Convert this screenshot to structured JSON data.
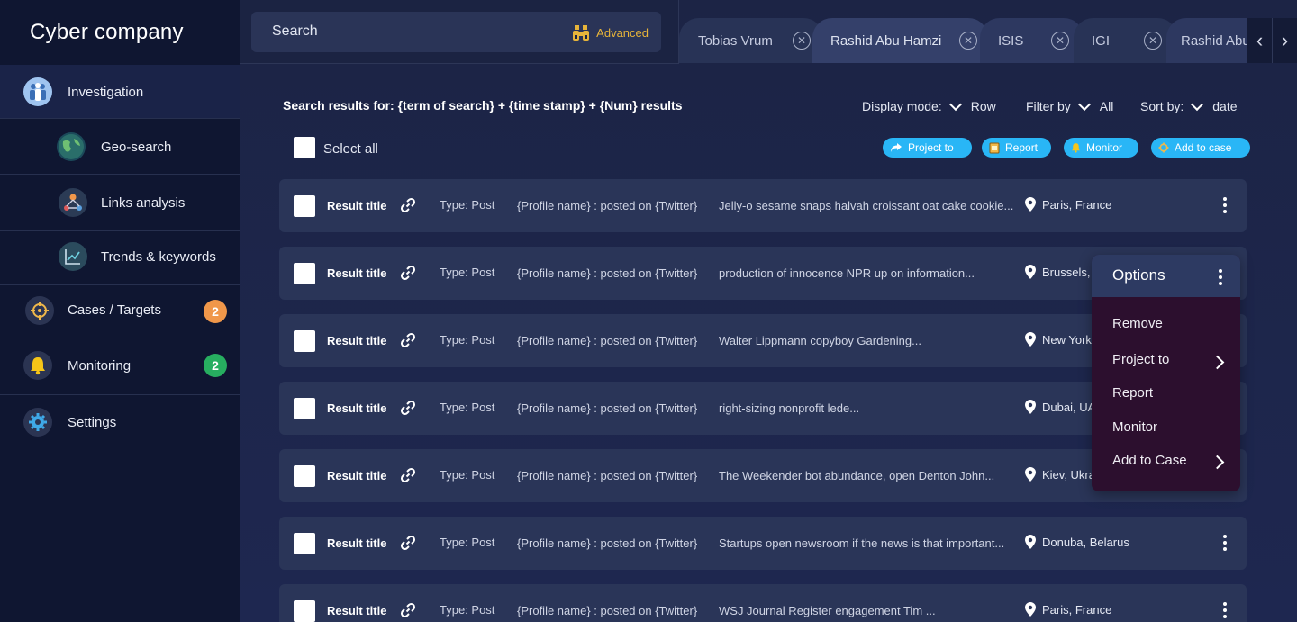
{
  "app": {
    "title": "Cyber company"
  },
  "sidebar": {
    "items": [
      {
        "label": "Investigation",
        "icon": "people-icon",
        "active": true
      },
      {
        "label": "Geo-search",
        "icon": "globe-icon",
        "sub": true
      },
      {
        "label": "Links analysis",
        "icon": "network-icon",
        "sub": true
      },
      {
        "label": "Trends & keywords",
        "icon": "trend-chart-icon",
        "sub": true
      },
      {
        "label": "Cases / Targets",
        "icon": "target-icon",
        "badge": "2",
        "badge_color": "#f0974a"
      },
      {
        "label": "Monitoring",
        "icon": "bell-icon",
        "badge": "2",
        "badge_color": "#27ae60"
      },
      {
        "label": "Settings",
        "icon": "gear-icon"
      }
    ]
  },
  "search": {
    "placeholder": "Search",
    "advanced_label": "Advanced",
    "advanced_icon": "binoculars-icon"
  },
  "tabs": [
    {
      "label": "Tobias Vrum"
    },
    {
      "label": "Rashid Abu Hamzi"
    },
    {
      "label": "ISIS"
    },
    {
      "label": "IGI"
    },
    {
      "label": "Rashid Abu Hamzi"
    }
  ],
  "results": {
    "heading": "Search results for:  {term of search} + {time stamp} + {Num} results",
    "display_mode_label": "Display mode:",
    "display_mode_value": "Row",
    "filter_label": "Filter by",
    "filter_value": "All",
    "sort_label": "Sort by:",
    "sort_value": "date",
    "select_all_label": "Select all"
  },
  "actions": [
    {
      "label": "Project to",
      "icon": "share-arrow-icon"
    },
    {
      "label": "Report",
      "icon": "report-icon"
    },
    {
      "label": "Monitor",
      "icon": "bell-icon"
    },
    {
      "label": "Add to case",
      "icon": "target-icon"
    }
  ],
  "rows": [
    {
      "title": "Result title",
      "type": "Type: Post",
      "profile": "{Profile name} : posted on {Twitter}",
      "snippet": "Jelly-o sesame snaps halvah croissant oat cake cookie...",
      "location": "Paris, France"
    },
    {
      "title": "Result title",
      "type": "Type: Post",
      "profile": "{Profile name} : posted on {Twitter}",
      "snippet": "production of innocence NPR up on  information...",
      "location": "Brussels,"
    },
    {
      "title": "Result title",
      "type": "Type: Post",
      "profile": "{Profile name} : posted on {Twitter}",
      "snippet": "Walter Lippmann copyboy Gardening...",
      "location": "New York"
    },
    {
      "title": "Result title",
      "type": "Type: Post",
      "profile": "{Profile name} : posted on {Twitter}",
      "snippet": "right-sizing nonprofit lede...",
      "location": "Dubai, UA"
    },
    {
      "title": "Result title",
      "type": "Type: Post",
      "profile": "{Profile name} : posted on {Twitter}",
      "snippet": "The Weekender bot abundance, open Denton John...",
      "location": "Kiev, Ukra"
    },
    {
      "title": "Result title",
      "type": "Type: Post",
      "profile": "{Profile name} : posted on {Twitter}",
      "snippet": "Startups open newsroom if the news is that important...",
      "location": "Donuba, Belarus"
    },
    {
      "title": "Result title",
      "type": "Type: Post",
      "profile": "{Profile name} : posted on {Twitter}",
      "snippet": "WSJ Journal Register engagement Tim ...",
      "location": "Paris, France"
    }
  ],
  "options_menu": {
    "title": "Options",
    "items": [
      {
        "label": "Remove"
      },
      {
        "label": "Project to",
        "submenu": true
      },
      {
        "label": "Report"
      },
      {
        "label": "Monitor"
      },
      {
        "label": "Add to Case",
        "submenu": true
      }
    ]
  },
  "colors": {
    "accent": "#29b6f6",
    "advanced": "#e7b43a",
    "menu_bg": "#2c0f2e"
  }
}
